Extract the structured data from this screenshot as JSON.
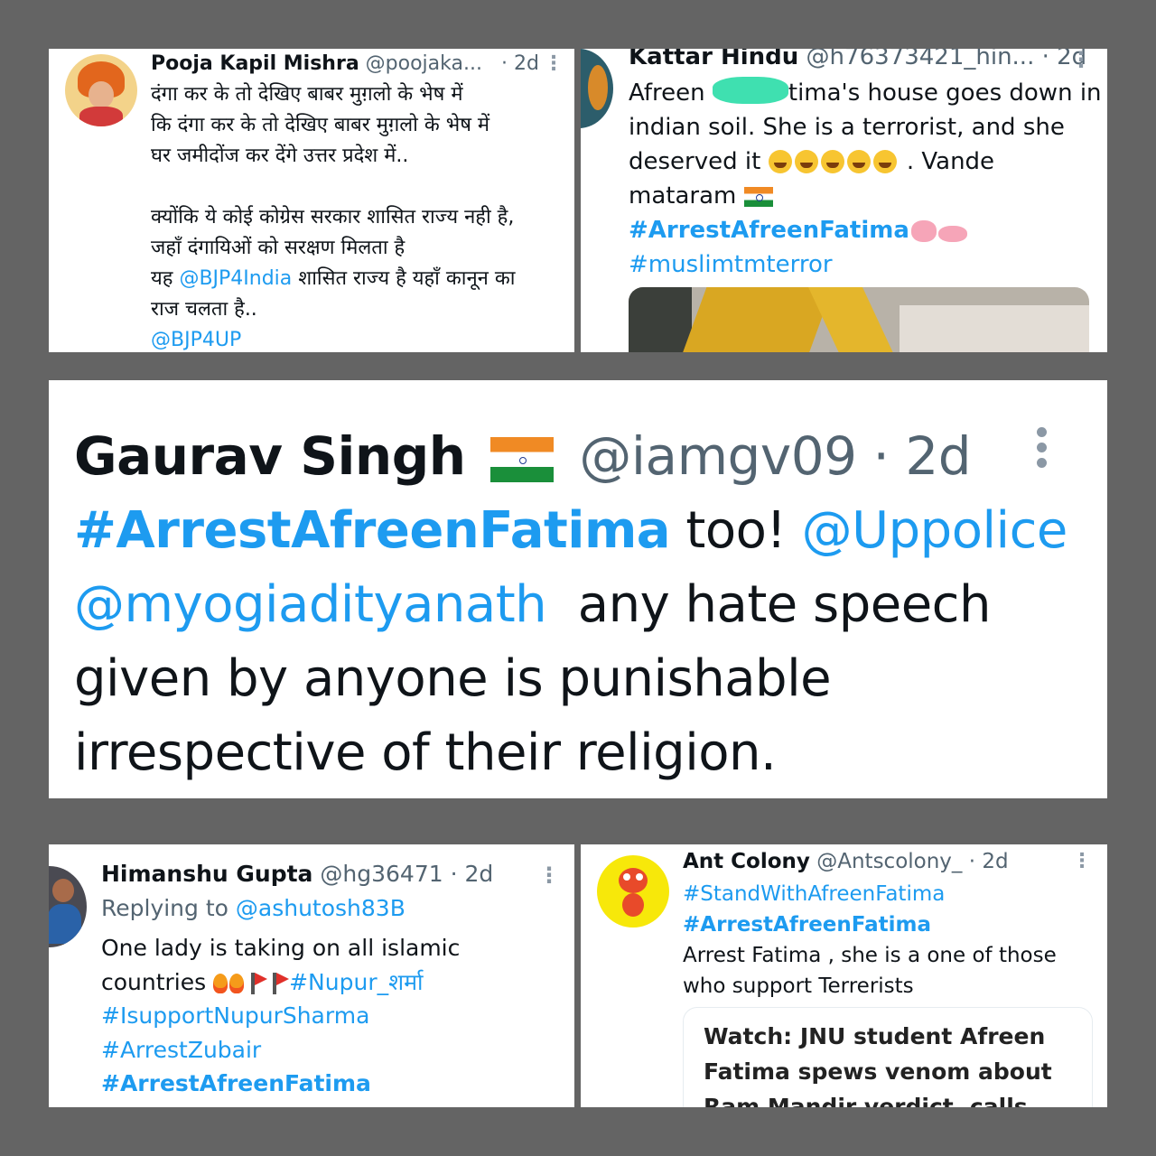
{
  "tweet1": {
    "name": "Pooja Kapil Mishra",
    "handle": "@poojaka...",
    "time": "· 2d",
    "lines": [
      "दंगा कर के तो देखिए बाबर मुग़लो के भेष में",
      "कि दंगा कर के तो देखिए बाबर मुग़लो के भेष में",
      "घर जमीदोंज कर देंगे उत्तर प्रदेश में.."
    ],
    "line4": "क्योंकि ये कोई कोग्रेस सरकार शासित राज्य नही है,",
    "line5": "जहाँ दंगायिओं को सरक्षण मिलता है",
    "line6_pre": "यह ",
    "line6_mention": "@BJP4India",
    "line6_post": " शासित राज्य है यहाँ कानून का",
    "line7": "राज चलता है..",
    "mention_last": "@BJP4UP"
  },
  "tweet2": {
    "name": "Kattar Hindu",
    "handle": "@h76373421_hin...",
    "time": "· 2d",
    "line1_a": "Afreen ",
    "line1_b": "tima's house goes down in",
    "line2": "indian soil. She is a terrorist, and she",
    "line3_a": "deserved it ",
    "line3_b": " . Vande",
    "line4": "mataram ",
    "hashtag1": "#ArrestAfreenFatima",
    "hashtag2": "#muslimtmterror"
  },
  "tweet3": {
    "name": "Gaurav Singh",
    "handle": "@iamgv09",
    "time": "· 2d",
    "hashtag": "#ArrestAfreenFatima",
    "text_too": " too! ",
    "mention1": "@Uppolice",
    "mention2": "@myogiadityanath",
    "text1": "  any hate speech",
    "text2": "given by anyone is punishable",
    "text3": "irrespective of their religion."
  },
  "tweet4": {
    "name": "Himanshu Gupta",
    "handle": "@hg36471",
    "time": "· 2d",
    "replying_label": "Replying to ",
    "replying_handle": "@ashutosh83B",
    "line1": "One lady is taking on all islamic",
    "line2": "countries ",
    "tag1": "#Nupur_शर्मा",
    "tag2": "#IsupportNupurSharma",
    "tag3": "#ArrestZubair",
    "tag4": "#ArrestAfreenFatima"
  },
  "tweet5": {
    "name": "Ant Colony",
    "handle": "@Antscolony_",
    "time": "· 2d",
    "tag1": "#StandWithAfreenFatima",
    "tag2": "#ArrestAfreenFatima",
    "line1": "Arrest Fatima , she is a one of those",
    "line2": "who support Terrerists",
    "card_line1": "Watch: JNU student Afreen",
    "card_line2": "Fatima spews venom about",
    "card_line3": "Ram Mandir verdict, calls"
  },
  "more_icon": "more-vertical-icon",
  "colors": {
    "link": "#1d9bf0",
    "background": "#646464",
    "handle": "#536471"
  }
}
